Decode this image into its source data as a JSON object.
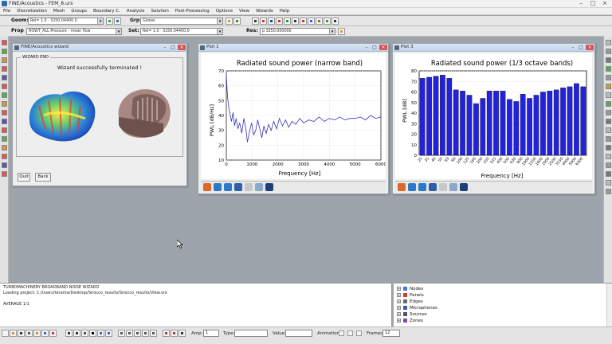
{
  "app": {
    "title": "FINE/Acoustics - FEM_8.urs"
  },
  "menu": [
    "File",
    "Discretization",
    "Mesh",
    "Groups",
    "Boundary C.",
    "Analysis",
    "Solution",
    "Post-Processing",
    "Options",
    "View",
    "Wizards",
    "Help"
  ],
  "toolbar1": {
    "geom_label": "Geom:",
    "geom_value": "Rel= 1.0 · 3250.04400.0",
    "grp_label": "Grp:",
    "grp_value": "Global"
  },
  "toolbar2": {
    "prop_label": "Prop",
    "prop_value": "ROWT_ALL Pressure - mean flow",
    "set_label": "Set:",
    "set_value": "Rel= 1.0 · 3250.04400.0",
    "res_label": "Res:",
    "res_value": "p 3250.000000"
  },
  "wizard": {
    "title": "FINE/Acoustics wizard",
    "group_title": "WIZARD END",
    "message": "Wizard successfully terminated !",
    "quit_label": "Quit",
    "back_label": "Back"
  },
  "plot1": {
    "title": "Plot 1"
  },
  "plot3": {
    "title": "Plot 3"
  },
  "console": {
    "lines": [
      "TURBOMACHINERY BROADBAND NOISE WIZARD",
      "Loading project: C:/Users/teranta/Desktop/Sirocco_results/Sirocco_results/View.vrx",
      "",
      "AVERAGE 1/1"
    ]
  },
  "tree": {
    "items": [
      {
        "label": "Nodes",
        "color": "#3c7fd0"
      },
      {
        "label": "Panels",
        "color": "#d04030"
      },
      {
        "label": "Edges",
        "color": "#6a6a6a"
      },
      {
        "label": "Microphones",
        "color": "#3a5fa8"
      },
      {
        "label": "Sources",
        "color": "#555555"
      },
      {
        "label": "Zones",
        "color": "#7a4ea0"
      }
    ]
  },
  "bottom": {
    "amp_label": "Amp:",
    "amp_value": "1",
    "type_label": "Type:",
    "value_label": "Value:",
    "animation_label": "Animation:",
    "frames_label": "Frames:",
    "frames_value": "12"
  },
  "chart_data": [
    {
      "type": "line",
      "title": "Radiated sound power (narrow band)",
      "xlabel": "Frequency [Hz]",
      "ylabel": "PWL [dB/Hz]",
      "xlim": [
        0,
        6000
      ],
      "ylim": [
        10,
        70
      ],
      "xticks": [
        0,
        1000,
        2000,
        3000,
        4000,
        5000,
        6000
      ],
      "yticks": [
        10,
        20,
        30,
        40,
        50,
        60,
        70
      ],
      "grid": true,
      "color": "#3333bb",
      "x": [
        0,
        50,
        100,
        150,
        200,
        260,
        320,
        380,
        450,
        520,
        600,
        680,
        750,
        820,
        900,
        980,
        1060,
        1140,
        1220,
        1300,
        1380,
        1460,
        1550,
        1640,
        1740,
        1840,
        1950,
        2060,
        2180,
        2300,
        2420,
        2550,
        2700,
        2850,
        3000,
        3200,
        3400,
        3600,
        3800,
        4000,
        4200,
        4400,
        4600,
        4800,
        5000,
        5200,
        5400,
        5600,
        5800,
        6000
      ],
      "y": [
        67,
        52,
        45,
        40,
        36,
        42,
        33,
        38,
        31,
        35,
        28,
        38,
        32,
        22,
        29,
        35,
        27,
        30,
        37,
        31,
        25,
        33,
        28,
        34,
        30,
        36,
        31,
        38,
        33,
        37,
        32,
        36,
        34,
        38,
        35,
        37,
        36,
        39,
        36,
        38,
        37,
        39,
        37,
        38,
        38,
        39,
        37,
        40,
        38,
        39
      ]
    },
    {
      "type": "bar",
      "title": "Radiated sound power (1/3 octave bands)",
      "xlabel": "Frequency [Hz]",
      "ylabel": "PWL [dB]",
      "ylim": [
        0,
        80
      ],
      "yticks": [
        0,
        10,
        20,
        30,
        40,
        50,
        60,
        70,
        80
      ],
      "grid": true,
      "color": "#2222dd",
      "categories": [
        "25",
        "31",
        "40",
        "50",
        "63",
        "80",
        "100",
        "125",
        "160",
        "200",
        "250",
        "315",
        "400",
        "500",
        "630",
        "800",
        "1000",
        "1250",
        "1600",
        "2000",
        "2500",
        "3150",
        "4000",
        "5000",
        "6300"
      ],
      "values": [
        73,
        74,
        75,
        76,
        73,
        62,
        61,
        57,
        49,
        54,
        61,
        61,
        61,
        53,
        51,
        58,
        54,
        57,
        60,
        61,
        62,
        64,
        65,
        68,
        65
      ]
    }
  ]
}
